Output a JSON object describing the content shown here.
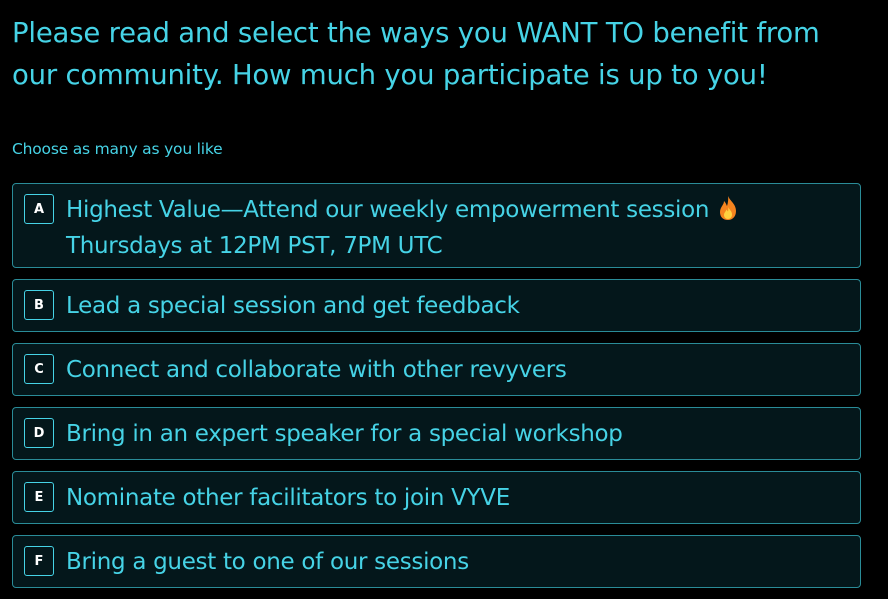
{
  "question": {
    "title": "Please read and select the ways you WANT TO benefit from our community. How much you participate is up to you!",
    "helper": "Choose as many as you like"
  },
  "options": [
    {
      "key": "A",
      "label": "Highest Value—Attend our weekly empowerment session",
      "icon": "fire-icon",
      "sublabel": "Thursdays at 12PM PST, 7PM UTC"
    },
    {
      "key": "B",
      "label": "Lead a special session and get feedback"
    },
    {
      "key": "C",
      "label": "Connect and collaborate with other revyvers"
    },
    {
      "key": "D",
      "label": "Bring in an expert speaker for a special workshop"
    },
    {
      "key": "E",
      "label": "Nominate other facilitators to join VYVE"
    },
    {
      "key": "F",
      "label": "Bring a guest to one of our sessions"
    }
  ],
  "colors": {
    "background": "#000000",
    "accent": "#46d3e6",
    "option_border": "#2a8c98",
    "option_background": "#04171b"
  }
}
